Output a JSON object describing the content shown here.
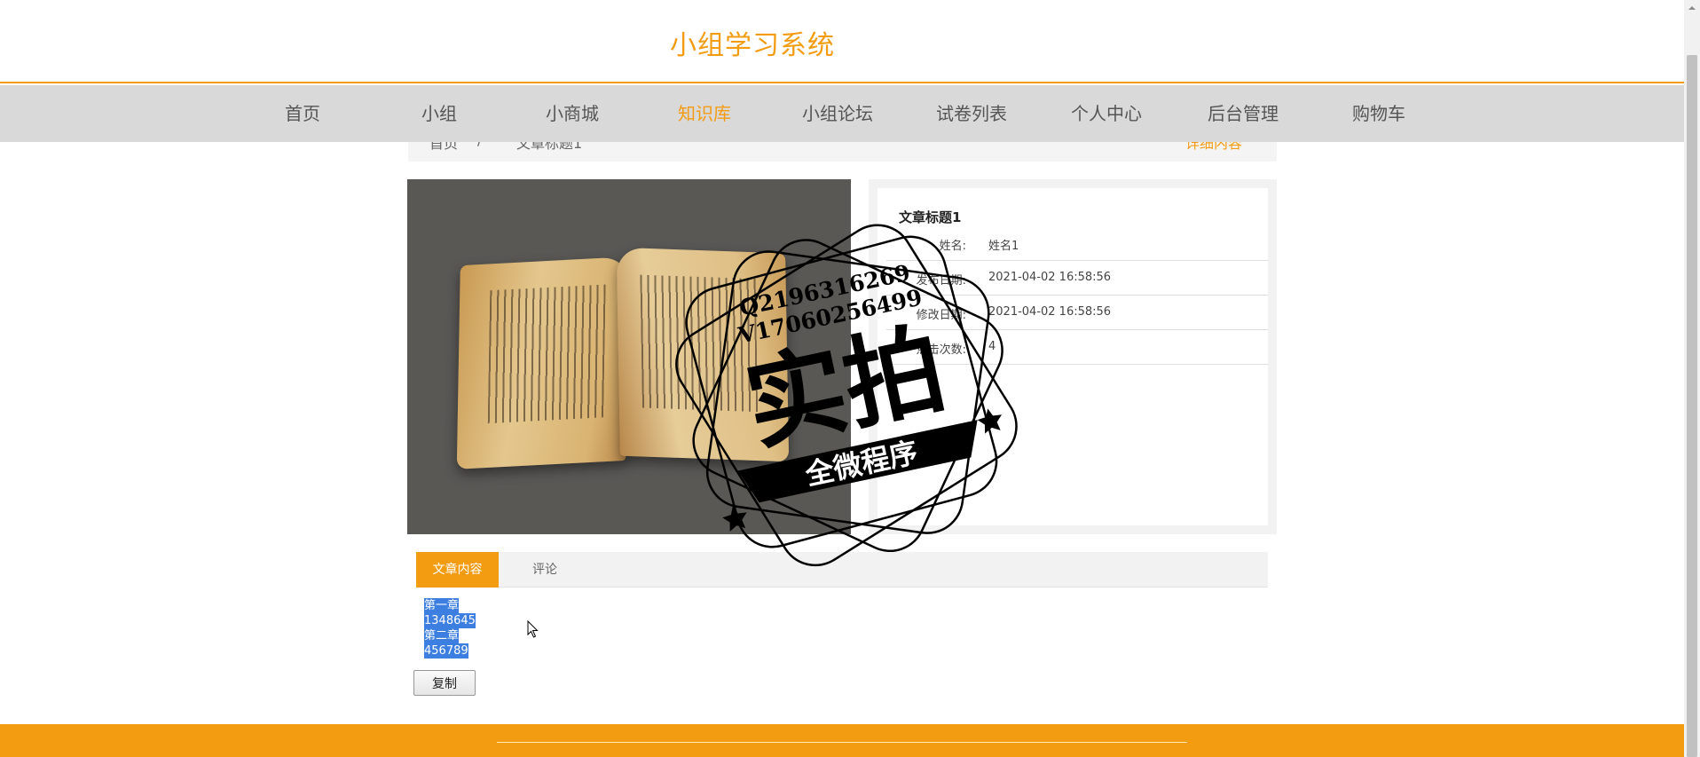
{
  "header": {
    "site_title": "小组学习系统"
  },
  "nav": {
    "items": [
      {
        "label": "首页"
      },
      {
        "label": "小组"
      },
      {
        "label": "小商城"
      },
      {
        "label": "知识库",
        "active": true
      },
      {
        "label": "小组论坛"
      },
      {
        "label": "试卷列表"
      },
      {
        "label": "个人中心"
      },
      {
        "label": "后台管理"
      },
      {
        "label": "购物车"
      }
    ]
  },
  "breadcrumb": {
    "home": "首页",
    "separator": "/",
    "current": "文章标题1",
    "right_link": "详细内容"
  },
  "article": {
    "title": "文章标题1",
    "fields": [
      {
        "label": "姓名:",
        "value": "姓名1"
      },
      {
        "label": "发布日期:",
        "value": "2021-04-02 16:58:56"
      },
      {
        "label": "修改日期:",
        "value": "2021-04-02 16:58:56"
      },
      {
        "label": "点击次数:",
        "value": "4"
      }
    ]
  },
  "tabs": {
    "content_label": "文章内容",
    "comments_label": "评论"
  },
  "content": {
    "lines": [
      "第一章",
      "1348645",
      "第二章",
      "456789"
    ]
  },
  "actions": {
    "copy_label": "复制"
  },
  "watermark": {
    "contact_q": "Q2196316269",
    "contact_v": "V17060256499",
    "main_text": "实拍",
    "banner_text": "全微程序"
  },
  "colors": {
    "accent": "#f39c12",
    "nav_bg": "#d9d9d9",
    "selection": "#3d7fe0"
  }
}
